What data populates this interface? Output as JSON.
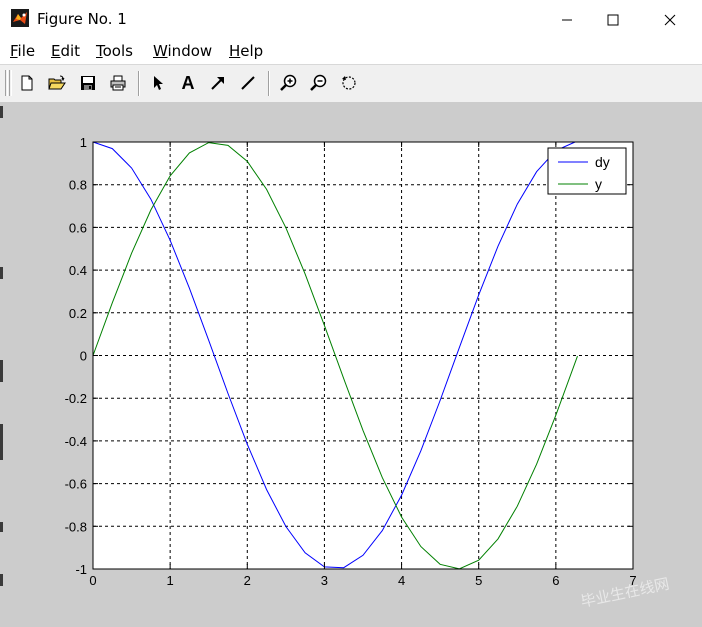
{
  "window": {
    "title": "Figure No. 1"
  },
  "menu": {
    "items": [
      {
        "label": "File",
        "accel": "F",
        "rest": "ile"
      },
      {
        "label": "Edit",
        "accel": "E",
        "rest": "dit"
      },
      {
        "label": "Tools",
        "accel": "T",
        "rest": "ools"
      },
      {
        "label": "Window",
        "accel": "W",
        "rest": "indow"
      },
      {
        "label": "Help",
        "accel": "H",
        "rest": "elp"
      }
    ]
  },
  "toolbar": {
    "buttons": [
      "new-figure-icon",
      "open-file-icon",
      "save-icon",
      "print-icon",
      "select-arrow-icon",
      "insert-text-icon",
      "insert-arrow-icon",
      "insert-line-icon",
      "zoom-in-icon",
      "zoom-out-icon",
      "rotate-3d-icon"
    ],
    "text_tool_glyph": "A"
  },
  "watermark": {
    "text": "毕业生在线网"
  },
  "chart_data": {
    "type": "line",
    "xlim": [
      0,
      7
    ],
    "ylim": [
      -1,
      1
    ],
    "xticks": [
      0,
      1,
      2,
      3,
      4,
      5,
      6,
      7
    ],
    "yticks": [
      1,
      0.8,
      0.6,
      0.4,
      0.2,
      0,
      -0.2,
      -0.4,
      -0.6,
      -0.8,
      -1
    ],
    "xtick_labels": [
      "0",
      "1",
      "2",
      "3",
      "4",
      "5",
      "6",
      "7"
    ],
    "ytick_labels": [
      "1",
      "0.8",
      "0.6",
      "0.4",
      "0.2",
      "0",
      "-0.2",
      "-0.4",
      "-0.6",
      "-0.8",
      "-1"
    ],
    "grid": true,
    "legend_position": "top-right",
    "series": [
      {
        "name": "dy",
        "color": "#0000ff",
        "x": [
          0,
          0.25,
          0.5,
          0.75,
          1,
          1.25,
          1.5,
          1.75,
          2,
          2.25,
          2.5,
          2.75,
          3,
          3.25,
          3.5,
          3.75,
          4,
          4.25,
          4.5,
          4.75,
          5,
          5.25,
          5.5,
          5.75,
          6,
          6.25
        ],
        "y": [
          1,
          0.969,
          0.878,
          0.732,
          0.54,
          0.315,
          0.071,
          -0.178,
          -0.416,
          -0.628,
          -0.801,
          -0.924,
          -0.99,
          -0.994,
          -0.936,
          -0.82,
          -0.654,
          -0.446,
          -0.211,
          0.038,
          0.284,
          0.512,
          0.709,
          0.861,
          0.96,
          1.0
        ]
      },
      {
        "name": "y",
        "color": "#008000",
        "x": [
          0,
          0.25,
          0.5,
          0.75,
          1,
          1.25,
          1.5,
          1.75,
          2,
          2.25,
          2.5,
          2.75,
          3,
          3.25,
          3.5,
          3.75,
          4,
          4.25,
          4.5,
          4.75,
          5,
          5.25,
          5.5,
          5.75,
          6,
          6.28
        ],
        "y": [
          0,
          0.247,
          0.479,
          0.682,
          0.841,
          0.949,
          0.997,
          0.984,
          0.909,
          0.778,
          0.598,
          0.382,
          0.141,
          -0.108,
          -0.351,
          -0.572,
          -0.757,
          -0.895,
          -0.978,
          -0.999,
          -0.959,
          -0.859,
          -0.706,
          -0.509,
          -0.279,
          -0.003
        ]
      }
    ]
  }
}
